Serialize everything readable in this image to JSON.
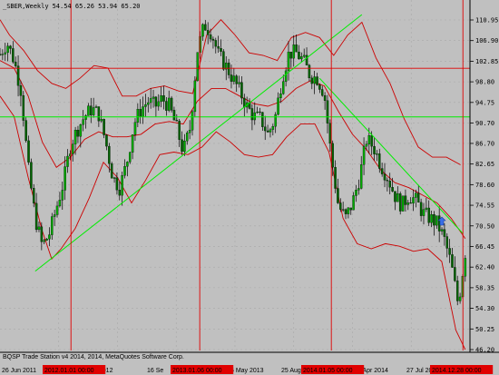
{
  "header": {
    "symbol_label": "_SBER,Weekly",
    "ohlc": "54.54 65.26 53.94 65.20"
  },
  "footer": {
    "copyright": "BQSP Trade Station v4 2014, 2014, MetaQuotes Software Corp."
  },
  "price_axis": {
    "ticks": [
      "110.95",
      "106.90",
      "102.85",
      "98.80",
      "94.75",
      "90.70",
      "86.70",
      "82.65",
      "78.60",
      "74.55",
      "70.50",
      "66.45",
      "62.40",
      "58.35",
      "54.30",
      "50.25",
      "46.20"
    ],
    "min": 46.2,
    "max": 110.95,
    "current_price": "65.20",
    "level_labels": {
      "red": "101.46",
      "green": "91.91"
    }
  },
  "time_axis": {
    "ticks": [
      "26 Jun 2011",
      "27 May 2012",
      "16 Se",
      "5 May 2013",
      "25 Aug",
      "6 Apr 2014",
      "27 Jul 2014"
    ],
    "highlighted": [
      "2012.01.01 00:00",
      "2013.01.06 00:00",
      "2014.01.05 00:00",
      "2014.12.28 00:00"
    ]
  },
  "colors": {
    "background": "#c0c0c0",
    "grid": "#a8a8a8",
    "candle_bull": "#00aa00",
    "candle_bear": "#006400",
    "bands": "#cc0000",
    "red_levels": "#e00000",
    "green_lines": "#00ee00",
    "arrow": "#3a6ee8"
  },
  "chart_data": {
    "type": "candlestick",
    "title": "_SBER,Weekly",
    "last_close": 65.2,
    "ylim": [
      46.2,
      110.95
    ],
    "horizontal_levels": [
      {
        "value": 101.46,
        "color": "red"
      },
      {
        "value": 91.91,
        "color": "green"
      }
    ],
    "vertical_markers": [
      "2012.01.01 00:00",
      "2013.01.06 00:00",
      "2014.01.05 00:00",
      "2014.12.28 00:00"
    ],
    "trendlines": [
      {
        "color": "green",
        "from": [
          0.075,
          61.6
        ],
        "to": [
          0.77,
          112.0
        ]
      },
      {
        "color": "green",
        "from": [
          0.68,
          99.5
        ],
        "to": [
          0.985,
          69.0
        ]
      }
    ],
    "price_series": [
      [
        0.0,
        104.2
      ],
      [
        0.015,
        106.5
      ],
      [
        0.03,
        103.0
      ],
      [
        0.045,
        97.0
      ],
      [
        0.06,
        82.0
      ],
      [
        0.075,
        72.0
      ],
      [
        0.09,
        66.5
      ],
      [
        0.105,
        69.0
      ],
      [
        0.12,
        74.0
      ],
      [
        0.135,
        79.0
      ],
      [
        0.15,
        86.5
      ],
      [
        0.165,
        89.5
      ],
      [
        0.18,
        92.0
      ],
      [
        0.195,
        93.5
      ],
      [
        0.21,
        92.5
      ],
      [
        0.225,
        87.0
      ],
      [
        0.24,
        80.0
      ],
      [
        0.255,
        78.0
      ],
      [
        0.27,
        83.0
      ],
      [
        0.285,
        90.5
      ],
      [
        0.3,
        93.5
      ],
      [
        0.315,
        95.0
      ],
      [
        0.33,
        94.0
      ],
      [
        0.345,
        95.5
      ],
      [
        0.36,
        94.0
      ],
      [
        0.375,
        90.0
      ],
      [
        0.39,
        85.0
      ],
      [
        0.405,
        90.0
      ],
      [
        0.42,
        105.0
      ],
      [
        0.435,
        110.0
      ],
      [
        0.45,
        108.5
      ],
      [
        0.465,
        104.0
      ],
      [
        0.48,
        102.0
      ],
      [
        0.495,
        99.5
      ],
      [
        0.51,
        97.0
      ],
      [
        0.525,
        94.0
      ],
      [
        0.54,
        92.0
      ],
      [
        0.555,
        91.5
      ],
      [
        0.57,
        88.5
      ],
      [
        0.585,
        91.5
      ],
      [
        0.6,
        99.5
      ],
      [
        0.615,
        104.5
      ],
      [
        0.63,
        104.5
      ],
      [
        0.645,
        103.0
      ],
      [
        0.66,
        100.0
      ],
      [
        0.675,
        99.5
      ],
      [
        0.69,
        96.5
      ],
      [
        0.705,
        84.0
      ],
      [
        0.72,
        74.5
      ],
      [
        0.735,
        72.0
      ],
      [
        0.75,
        75.0
      ],
      [
        0.765,
        80.0
      ],
      [
        0.78,
        87.5
      ],
      [
        0.795,
        86.0
      ],
      [
        0.81,
        82.5
      ],
      [
        0.825,
        80.0
      ],
      [
        0.84,
        76.5
      ],
      [
        0.855,
        74.5
      ],
      [
        0.87,
        76.5
      ],
      [
        0.885,
        75.5
      ],
      [
        0.9,
        73.0
      ],
      [
        0.915,
        72.0
      ],
      [
        0.93,
        71.0
      ],
      [
        0.945,
        68.0
      ],
      [
        0.96,
        63.0
      ],
      [
        0.975,
        55.0
      ],
      [
        0.99,
        65.2
      ]
    ],
    "band_upper": [
      [
        0.0,
        111.0
      ],
      [
        0.02,
        108.0
      ],
      [
        0.05,
        105.0
      ],
      [
        0.08,
        101.0
      ],
      [
        0.11,
        98.5
      ],
      [
        0.14,
        97.5
      ],
      [
        0.17,
        99.5
      ],
      [
        0.2,
        102.0
      ],
      [
        0.23,
        101.5
      ],
      [
        0.26,
        96.0
      ],
      [
        0.29,
        96.0
      ],
      [
        0.32,
        97.5
      ],
      [
        0.35,
        98.0
      ],
      [
        0.38,
        97.0
      ],
      [
        0.41,
        96.5
      ],
      [
        0.44,
        108.0
      ],
      [
        0.47,
        111.0
      ],
      [
        0.5,
        108.0
      ],
      [
        0.53,
        104.5
      ],
      [
        0.56,
        104.0
      ],
      [
        0.59,
        103.0
      ],
      [
        0.62,
        107.5
      ],
      [
        0.65,
        108.5
      ],
      [
        0.68,
        107.5
      ],
      [
        0.71,
        104.0
      ],
      [
        0.74,
        108.0
      ],
      [
        0.77,
        110.5
      ],
      [
        0.8,
        103.5
      ],
      [
        0.83,
        98.5
      ],
      [
        0.86,
        91.5
      ],
      [
        0.89,
        86.0
      ],
      [
        0.92,
        84.0
      ],
      [
        0.95,
        84.0
      ],
      [
        0.98,
        82.5
      ]
    ],
    "band_lower": [
      [
        0.0,
        96.0
      ],
      [
        0.03,
        92.0
      ],
      [
        0.06,
        80.0
      ],
      [
        0.09,
        69.5
      ],
      [
        0.11,
        64.0
      ],
      [
        0.13,
        66.0
      ],
      [
        0.16,
        70.0
      ],
      [
        0.19,
        76.0
      ],
      [
        0.22,
        83.0
      ],
      [
        0.25,
        80.0
      ],
      [
        0.28,
        75.0
      ],
      [
        0.31,
        79.5
      ],
      [
        0.34,
        84.5
      ],
      [
        0.37,
        85.0
      ],
      [
        0.4,
        84.5
      ],
      [
        0.43,
        86.0
      ],
      [
        0.46,
        89.0
      ],
      [
        0.49,
        87.0
      ],
      [
        0.52,
        84.5
      ],
      [
        0.55,
        84.0
      ],
      [
        0.58,
        84.5
      ],
      [
        0.61,
        88.0
      ],
      [
        0.64,
        90.5
      ],
      [
        0.67,
        90.5
      ],
      [
        0.7,
        85.0
      ],
      [
        0.73,
        72.0
      ],
      [
        0.76,
        67.0
      ],
      [
        0.79,
        66.0
      ],
      [
        0.82,
        67.0
      ],
      [
        0.85,
        66.5
      ],
      [
        0.88,
        65.5
      ],
      [
        0.91,
        66.0
      ],
      [
        0.94,
        63.5
      ],
      [
        0.97,
        50.0
      ],
      [
        0.99,
        46.2
      ]
    ],
    "band_mid": [
      [
        0.0,
        103.0
      ],
      [
        0.03,
        101.5
      ],
      [
        0.06,
        96.0
      ],
      [
        0.09,
        87.0
      ],
      [
        0.12,
        82.0
      ],
      [
        0.15,
        84.0
      ],
      [
        0.18,
        87.5
      ],
      [
        0.21,
        89.0
      ],
      [
        0.24,
        88.0
      ],
      [
        0.27,
        88.0
      ],
      [
        0.3,
        88.5
      ],
      [
        0.33,
        90.5
      ],
      [
        0.36,
        91.0
      ],
      [
        0.39,
        90.5
      ],
      [
        0.42,
        95.0
      ],
      [
        0.45,
        97.5
      ],
      [
        0.48,
        97.5
      ],
      [
        0.51,
        96.0
      ],
      [
        0.54,
        94.5
      ],
      [
        0.57,
        94.0
      ],
      [
        0.6,
        95.0
      ],
      [
        0.63,
        97.5
      ],
      [
        0.66,
        99.0
      ],
      [
        0.69,
        98.0
      ],
      [
        0.72,
        93.0
      ],
      [
        0.75,
        88.5
      ],
      [
        0.78,
        85.5
      ],
      [
        0.81,
        81.5
      ],
      [
        0.84,
        79.0
      ],
      [
        0.87,
        78.0
      ],
      [
        0.9,
        76.5
      ],
      [
        0.93,
        75.0
      ],
      [
        0.96,
        72.0
      ],
      [
        0.99,
        68.0
      ]
    ]
  }
}
